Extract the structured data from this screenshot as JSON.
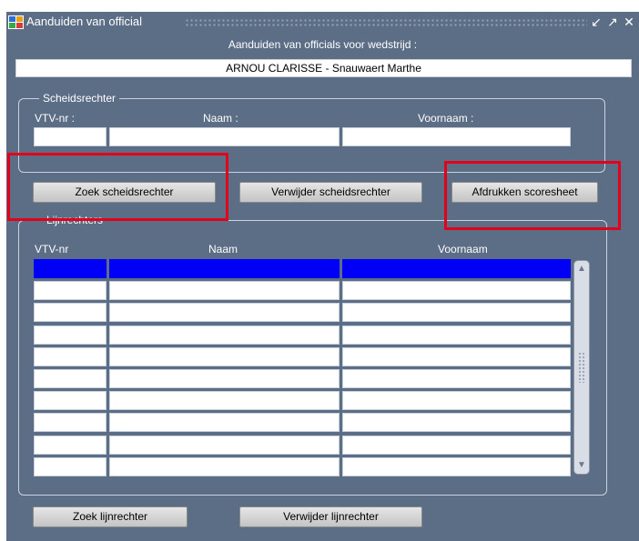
{
  "window": {
    "title": "Aanduiden van official",
    "controls": [
      "minimize",
      "maximize",
      "close"
    ]
  },
  "header": {
    "label": "Aanduiden van officials voor wedstrijd :",
    "match": "ARNOU CLARISSE - Snauwaert Marthe"
  },
  "referee": {
    "legend": "Scheidsrechter",
    "col_nr": "VTV-nr :",
    "col_name": "Naam :",
    "col_firstname": "Voornaam :",
    "values": {
      "nr": "",
      "name": "",
      "firstname": ""
    }
  },
  "buttons": {
    "search_referee": "Zoek scheidsrechter",
    "remove_referee": "Verwijder scheidsrechter",
    "print_scoresheet": "Afdrukken scoresheet",
    "search_linesman": "Zoek lijnrechter",
    "remove_linesman": "Verwijder lijnrechter"
  },
  "linesmen": {
    "legend": "Lijnrechters",
    "col_nr": "VTV-nr",
    "col_name": "Naam",
    "col_firstname": "Voornaam",
    "rows": [
      {
        "nr": "",
        "name": "",
        "firstname": "",
        "selected": true
      },
      {
        "nr": "",
        "name": "",
        "firstname": ""
      },
      {
        "nr": "",
        "name": "",
        "firstname": ""
      },
      {
        "nr": "",
        "name": "",
        "firstname": ""
      },
      {
        "nr": "",
        "name": "",
        "firstname": ""
      },
      {
        "nr": "",
        "name": "",
        "firstname": ""
      },
      {
        "nr": "",
        "name": "",
        "firstname": ""
      },
      {
        "nr": "",
        "name": "",
        "firstname": ""
      },
      {
        "nr": "",
        "name": "",
        "firstname": ""
      },
      {
        "nr": "",
        "name": "",
        "firstname": ""
      }
    ]
  },
  "colors": {
    "background": "#5c6d86",
    "selection": "#0000f6",
    "highlight": "#e3001b"
  }
}
